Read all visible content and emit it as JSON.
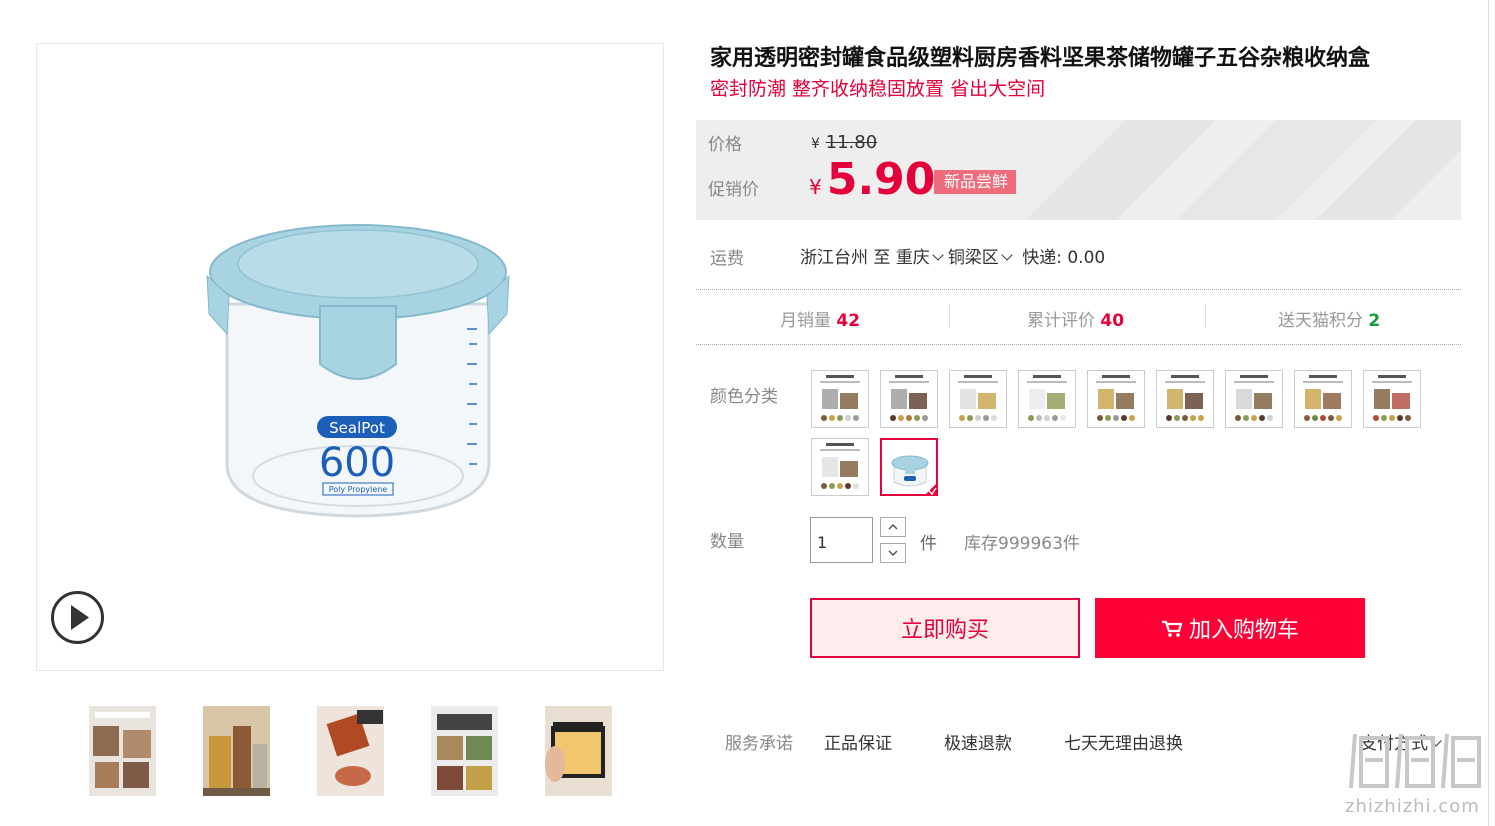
{
  "product": {
    "title": "家用透明密封罐食品级塑料厨房香料坚果茶储物罐子五谷杂粮收纳盒",
    "subtitle": "密封防潮 整齐收纳稳固放置 省出大空间",
    "image_text": {
      "brand": "SealPot",
      "capacity": "600",
      "material": "Poly Propylene"
    }
  },
  "price": {
    "label": "价格",
    "currency": "¥",
    "original": "11.80",
    "promo_label": "促销价",
    "promo": "5.90",
    "badge": "新品尝鲜"
  },
  "shipping": {
    "label": "运费",
    "from": "浙江台州",
    "to_word": "至",
    "city": "重庆",
    "district": "铜梁区",
    "express": "快递: 0.00"
  },
  "stats": {
    "monthly_label": "月销量",
    "monthly_value": "42",
    "reviews_label": "累计评价",
    "reviews_value": "40",
    "points_label": "送天猫积分",
    "points_value": "2"
  },
  "color": {
    "label": "颜色分类",
    "selected_index": 10,
    "swatch_count": 11
  },
  "quantity": {
    "label": "数量",
    "value": "1",
    "unit": "件",
    "stock": "库存999963件"
  },
  "buttons": {
    "buy_now": "立即购买",
    "add_to_cart": "加入购物车"
  },
  "service": {
    "label": "服务承诺",
    "items": [
      "正品保证",
      "极速退款",
      "七天无理由退换"
    ],
    "payment": "支付方式"
  },
  "watermark": "zhizhizhi.com",
  "colors": {
    "accent": "#e4003a",
    "cart_button": "#ff0036",
    "green": "#159b3b",
    "lid_blue": "#a8d3e2"
  }
}
